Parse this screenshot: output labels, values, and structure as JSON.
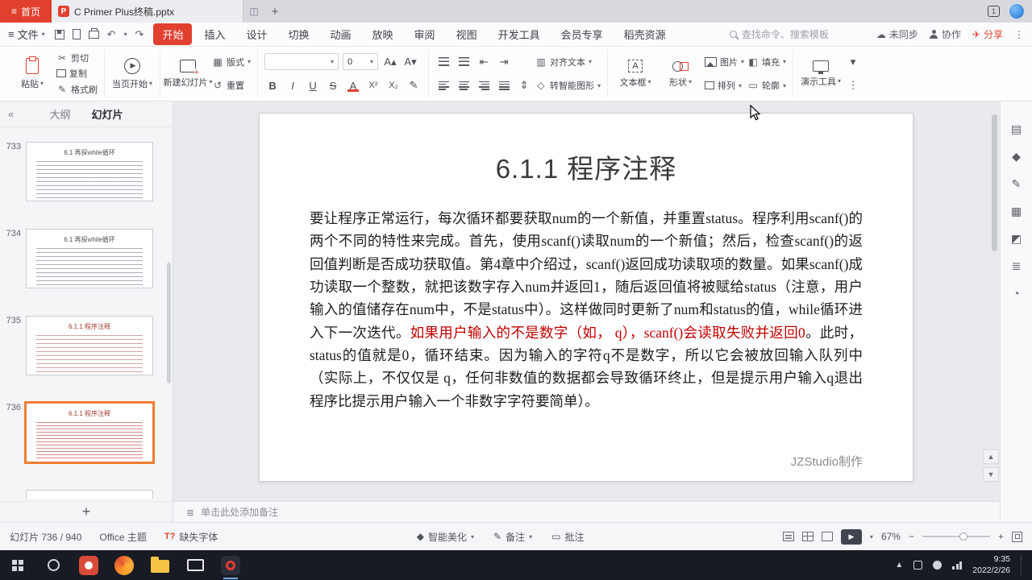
{
  "icons": {
    "hamburger": "≡",
    "caret": "▾",
    "plus": "+",
    "ppt": "P",
    "undo": "↶",
    "redo": "↷",
    "cut": "✂",
    "painter": "✎",
    "cloud": "☁",
    "plane": "✈",
    "kebab": "⋮",
    "collapse": "«",
    "play": "▶",
    "bold": "B",
    "italic": "I",
    "underline": "U",
    "strike": "S",
    "font_color": "A",
    "superscript": "X²",
    "subscript": "X₂",
    "grow_font": "A▴",
    "shrink_font": "A▾",
    "layout": "▦",
    "reset": "↺",
    "indent_less": "⇤",
    "indent_more": "⇥",
    "line_spacing": "⇕",
    "align_text": "▥",
    "smartart": "◇",
    "fill": "◧",
    "outline_shape": "▭",
    "notes": "≣",
    "beautify": "◆",
    "pencil": "✎",
    "comment": "▭",
    "up": "▲",
    "down": "▼",
    "minus": "−",
    "missing_font": "T?",
    "panel1": "▤",
    "panel2": "◆",
    "panel3": "✎",
    "panel4": "▦",
    "panel5": "◩",
    "panel6": "≣",
    "panel7": "◔"
  },
  "titlebar": {
    "home_tab_label": "首页",
    "doc_tab_label": "C Primer Plus终稿.pptx",
    "window_badge": "1"
  },
  "menubar": {
    "file_label": "文件",
    "tabs": [
      "开始",
      "插入",
      "设计",
      "切换",
      "动画",
      "放映",
      "审阅",
      "视图",
      "开发工具",
      "会员专享",
      "稻壳资源"
    ],
    "active_tab": "开始",
    "search_placeholder": "查找命令、搜索模板",
    "sync_label": "未同步",
    "collab_label": "协作",
    "share_label": "分享"
  },
  "ribbon": {
    "paste_label": "粘贴",
    "cut_label": "剪切",
    "copy_label": "复制",
    "format_painter_label": "格式刷",
    "play_from_label": "当页开始",
    "new_slide_label": "新建幻灯片",
    "layout_label": "版式",
    "reset_label": "重置",
    "font_size_value": "0",
    "align_text_label": "对齐文本",
    "smartart_label": "转智能图形",
    "textbox_label": "文本框",
    "shapes_label": "形状",
    "picture_label": "图片",
    "arrange_label": "排列",
    "fill_label": "填充",
    "outline_label": "轮廓",
    "present_tools_label": "演示工具"
  },
  "sidebar": {
    "outline_tab": "大纲",
    "slides_tab": "幻灯片",
    "slides": [
      {
        "number": "733",
        "title": "6.1 再探while循环",
        "tone": "gray",
        "selected": false
      },
      {
        "number": "734",
        "title": "6.1 再探while循环",
        "tone": "gray",
        "selected": false
      },
      {
        "number": "735",
        "title": "6.1.1 程序注释",
        "tone": "mixed",
        "selected": false
      },
      {
        "number": "736",
        "title": "6.1.1 程序注释",
        "tone": "red",
        "selected": true
      }
    ],
    "add_slide_label": "+"
  },
  "slide": {
    "title": "6.1.1 程序注释",
    "segments": [
      {
        "color": "black",
        "text": "要让程序正常运行，每次循环都要获取num的一个新值，并重置status。程序利用scanf()的两个不同的特性来完成。首先，使用scanf()读取num的一个新值；然后，检查scanf()的返回值判断是否成功获取值。第4章中介绍过，scanf()返回成功读取项的数量。如果scanf()成功读取一个整数，就把该数字存入num并返回1，随后返回值将被赋给status（注意，用户输入的值储存在num中，不是status中）。这样做同时更新了num和status的值，while循环进入下一次迭代。"
      },
      {
        "color": "red",
        "text": "如果用户输入的不是数字（如， q），scanf()会读取失败并返回0"
      },
      {
        "color": "black",
        "text": "。此时，status的值就是0，循环结束。因为输入的字符q不是数字，所以它会被放回输入队列中（实际上，不仅仅是 q，任何非数值的数据都会导致循环终止，但是提示用户输入q退出程序比提示用户输入一个非数字字符要简单）。"
      }
    ],
    "credit": "JZStudio制作"
  },
  "notes": {
    "placeholder": "单击此处添加备注"
  },
  "statusbar": {
    "slide_counter": "幻灯片 736 / 940",
    "theme_label": "Office 主题",
    "missing_font_label": "缺失字体",
    "beautify_label": "智能美化",
    "notes_label": "备注",
    "comments_label": "批注",
    "zoom_value": "67%"
  },
  "taskbar": {
    "time": "9:35",
    "date": "2022/2/26"
  }
}
